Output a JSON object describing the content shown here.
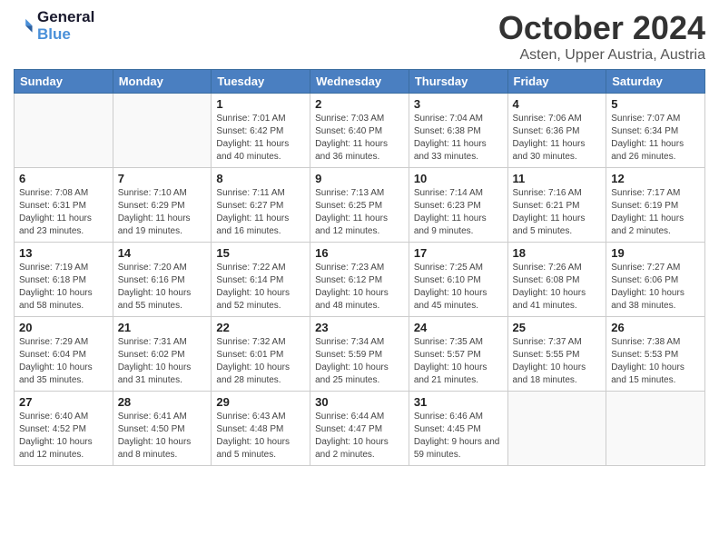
{
  "header": {
    "logo_line1": "General",
    "logo_line2": "Blue",
    "month_title": "October 2024",
    "location": "Asten, Upper Austria, Austria"
  },
  "weekdays": [
    "Sunday",
    "Monday",
    "Tuesday",
    "Wednesday",
    "Thursday",
    "Friday",
    "Saturday"
  ],
  "weeks": [
    [
      {
        "day": "",
        "info": ""
      },
      {
        "day": "",
        "info": ""
      },
      {
        "day": "1",
        "info": "Sunrise: 7:01 AM\nSunset: 6:42 PM\nDaylight: 11 hours and 40 minutes."
      },
      {
        "day": "2",
        "info": "Sunrise: 7:03 AM\nSunset: 6:40 PM\nDaylight: 11 hours and 36 minutes."
      },
      {
        "day": "3",
        "info": "Sunrise: 7:04 AM\nSunset: 6:38 PM\nDaylight: 11 hours and 33 minutes."
      },
      {
        "day": "4",
        "info": "Sunrise: 7:06 AM\nSunset: 6:36 PM\nDaylight: 11 hours and 30 minutes."
      },
      {
        "day": "5",
        "info": "Sunrise: 7:07 AM\nSunset: 6:34 PM\nDaylight: 11 hours and 26 minutes."
      }
    ],
    [
      {
        "day": "6",
        "info": "Sunrise: 7:08 AM\nSunset: 6:31 PM\nDaylight: 11 hours and 23 minutes."
      },
      {
        "day": "7",
        "info": "Sunrise: 7:10 AM\nSunset: 6:29 PM\nDaylight: 11 hours and 19 minutes."
      },
      {
        "day": "8",
        "info": "Sunrise: 7:11 AM\nSunset: 6:27 PM\nDaylight: 11 hours and 16 minutes."
      },
      {
        "day": "9",
        "info": "Sunrise: 7:13 AM\nSunset: 6:25 PM\nDaylight: 11 hours and 12 minutes."
      },
      {
        "day": "10",
        "info": "Sunrise: 7:14 AM\nSunset: 6:23 PM\nDaylight: 11 hours and 9 minutes."
      },
      {
        "day": "11",
        "info": "Sunrise: 7:16 AM\nSunset: 6:21 PM\nDaylight: 11 hours and 5 minutes."
      },
      {
        "day": "12",
        "info": "Sunrise: 7:17 AM\nSunset: 6:19 PM\nDaylight: 11 hours and 2 minutes."
      }
    ],
    [
      {
        "day": "13",
        "info": "Sunrise: 7:19 AM\nSunset: 6:18 PM\nDaylight: 10 hours and 58 minutes."
      },
      {
        "day": "14",
        "info": "Sunrise: 7:20 AM\nSunset: 6:16 PM\nDaylight: 10 hours and 55 minutes."
      },
      {
        "day": "15",
        "info": "Sunrise: 7:22 AM\nSunset: 6:14 PM\nDaylight: 10 hours and 52 minutes."
      },
      {
        "day": "16",
        "info": "Sunrise: 7:23 AM\nSunset: 6:12 PM\nDaylight: 10 hours and 48 minutes."
      },
      {
        "day": "17",
        "info": "Sunrise: 7:25 AM\nSunset: 6:10 PM\nDaylight: 10 hours and 45 minutes."
      },
      {
        "day": "18",
        "info": "Sunrise: 7:26 AM\nSunset: 6:08 PM\nDaylight: 10 hours and 41 minutes."
      },
      {
        "day": "19",
        "info": "Sunrise: 7:27 AM\nSunset: 6:06 PM\nDaylight: 10 hours and 38 minutes."
      }
    ],
    [
      {
        "day": "20",
        "info": "Sunrise: 7:29 AM\nSunset: 6:04 PM\nDaylight: 10 hours and 35 minutes."
      },
      {
        "day": "21",
        "info": "Sunrise: 7:31 AM\nSunset: 6:02 PM\nDaylight: 10 hours and 31 minutes."
      },
      {
        "day": "22",
        "info": "Sunrise: 7:32 AM\nSunset: 6:01 PM\nDaylight: 10 hours and 28 minutes."
      },
      {
        "day": "23",
        "info": "Sunrise: 7:34 AM\nSunset: 5:59 PM\nDaylight: 10 hours and 25 minutes."
      },
      {
        "day": "24",
        "info": "Sunrise: 7:35 AM\nSunset: 5:57 PM\nDaylight: 10 hours and 21 minutes."
      },
      {
        "day": "25",
        "info": "Sunrise: 7:37 AM\nSunset: 5:55 PM\nDaylight: 10 hours and 18 minutes."
      },
      {
        "day": "26",
        "info": "Sunrise: 7:38 AM\nSunset: 5:53 PM\nDaylight: 10 hours and 15 minutes."
      }
    ],
    [
      {
        "day": "27",
        "info": "Sunrise: 6:40 AM\nSunset: 4:52 PM\nDaylight: 10 hours and 12 minutes."
      },
      {
        "day": "28",
        "info": "Sunrise: 6:41 AM\nSunset: 4:50 PM\nDaylight: 10 hours and 8 minutes."
      },
      {
        "day": "29",
        "info": "Sunrise: 6:43 AM\nSunset: 4:48 PM\nDaylight: 10 hours and 5 minutes."
      },
      {
        "day": "30",
        "info": "Sunrise: 6:44 AM\nSunset: 4:47 PM\nDaylight: 10 hours and 2 minutes."
      },
      {
        "day": "31",
        "info": "Sunrise: 6:46 AM\nSunset: 4:45 PM\nDaylight: 9 hours and 59 minutes."
      },
      {
        "day": "",
        "info": ""
      },
      {
        "day": "",
        "info": ""
      }
    ]
  ]
}
